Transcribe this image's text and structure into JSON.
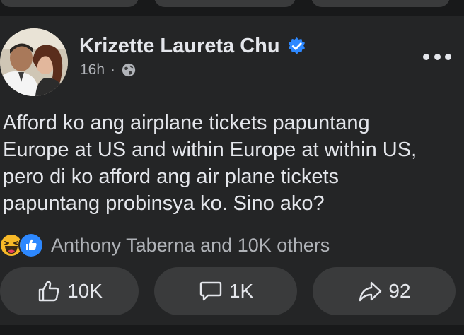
{
  "post": {
    "author": "Krizette Laureta Chu",
    "timestamp": "16h",
    "separator": "·",
    "audience_icon": "globe-icon",
    "verified_icon": "verified-badge-icon",
    "text_lines": [
      "Afford ko ang airplane tickets papuntang",
      "Europe at US and within Europe at within US,",
      "pero di ko afford ang air plane tickets",
      "papuntang probinsya ko. Sino ako?"
    ],
    "reactions_summary": "Anthony Taberna and 10K others",
    "reaction_icons": [
      "haha-icon",
      "like-icon"
    ]
  },
  "actions": {
    "like_count": "10K",
    "comment_count": "1K",
    "share_count": "92"
  },
  "colors": {
    "background": "#18191a",
    "card": "#242526",
    "button": "#3a3b3c",
    "text_primary": "#e4e6eb",
    "text_secondary": "#b0b3b8",
    "verified_blue": "#2d88ff",
    "haha_yellow": "#f7b928"
  }
}
